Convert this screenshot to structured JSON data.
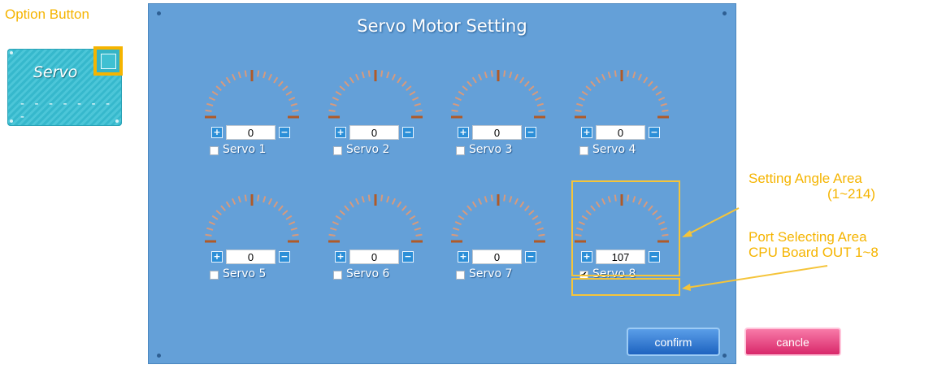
{
  "callout": {
    "option_button_label": "Option Button",
    "card_title": "Servo",
    "card_subtitle": "- - - - - - - -"
  },
  "dialog": {
    "title": "Servo Motor Setting",
    "servos": [
      {
        "label": "Servo 1",
        "value": "0",
        "checked": false
      },
      {
        "label": "Servo 2",
        "value": "0",
        "checked": false
      },
      {
        "label": "Servo 3",
        "value": "0",
        "checked": false
      },
      {
        "label": "Servo 4",
        "value": "0",
        "checked": false
      },
      {
        "label": "Servo 5",
        "value": "0",
        "checked": false
      },
      {
        "label": "Servo 6",
        "value": "0",
        "checked": false
      },
      {
        "label": "Servo 7",
        "value": "0",
        "checked": false
      },
      {
        "label": "Servo 8",
        "value": "107",
        "checked": true
      }
    ],
    "plus_glyph": "+",
    "minus_glyph": "−",
    "check_glyph": "✔",
    "confirm_label": "confirm",
    "cancel_label": "cancle"
  },
  "annotations": {
    "angle_area_line1": "Setting Angle Area",
    "angle_area_line2": "(1~214)",
    "port_area_line1": "Port Selecting Area",
    "port_area_line2": "CPU Board OUT 1~8"
  },
  "colors": {
    "dialog_bg": "#64a0d8",
    "highlight": "#f5c43a",
    "tick_light": "#d89a7c",
    "tick_dark": "#b05a28"
  }
}
